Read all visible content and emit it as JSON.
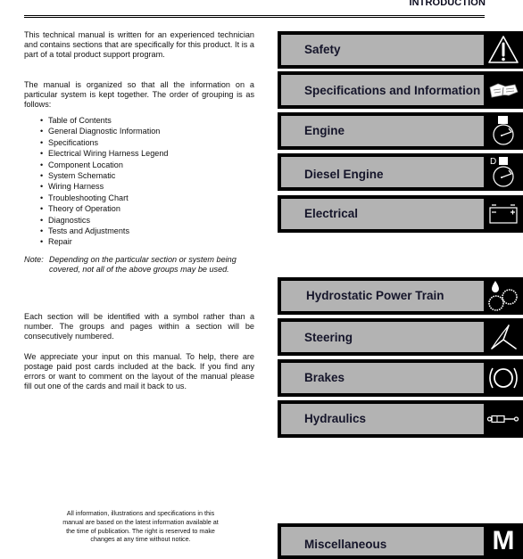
{
  "header": {
    "title": "INTRODUCTION"
  },
  "intro": {
    "paragraph1": "This technical manual is written for an experienced technician and contains sections that are specifically for this product. It is a part of a total product support program.",
    "paragraph2": "The manual is organized so that all the information on a particular system is kept together. The order of grouping is as follows:",
    "groups": [
      "Table of Contents",
      "General Diagnostic Information",
      "Specifications",
      "Electrical Wiring Harness Legend",
      "Component Location",
      "System Schematic",
      "Wiring Harness",
      "Troubleshooting Chart",
      "Theory of Operation",
      "Diagnostics",
      "Tests and Adjustments",
      "Repair"
    ],
    "note_label": "Note:",
    "note_text": "Depending on the particular section or system being covered, not all of the above groups may be used.",
    "paragraph3": "Each section will be identified with a symbol rather than a number. The groups and pages within a section will be consecutively numbered.",
    "paragraph4": "We appreciate your input on this manual. To help, there are postage paid post cards included at the back. If you find any errors or want to comment on the layout of the manual please fill out one of the cards and mail it back to us."
  },
  "footer": {
    "disclaimer": "All information, illustrations and specifications in this manual are based on the latest information available at the time of publication. The right is reserved to make changes at any time without notice."
  },
  "sections": [
    {
      "label": "Safety",
      "icon": "warning-triangle-icon"
    },
    {
      "label": "Specifications and Information",
      "icon": "open-book-icon"
    },
    {
      "label": "Engine",
      "icon": "engine-gauge-icon"
    },
    {
      "label": "Diesel Engine",
      "icon": "diesel-engine-gauge-icon",
      "icon_text": "D"
    },
    {
      "label": "Electrical",
      "icon": "battery-icon"
    },
    {
      "label": "Hydrostatic Power Train",
      "icon": "hydrostatic-gears-icon"
    },
    {
      "label": "Steering",
      "icon": "steering-icon"
    },
    {
      "label": "Brakes",
      "icon": "brakes-icon"
    },
    {
      "label": "Hydraulics",
      "icon": "hydraulic-cylinder-icon"
    },
    {
      "label": "Miscellaneous",
      "icon": "letter-m-icon",
      "icon_text": "M"
    }
  ],
  "colors": {
    "bar_background": "#000000",
    "label_background": "#b3b3b3",
    "label_text": "#15152a",
    "icon_stroke": "#ffffff"
  }
}
